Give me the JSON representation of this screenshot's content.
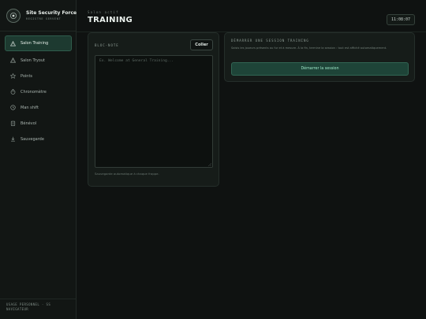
{
  "brand": {
    "title": "Site Security Force",
    "subtitle": "REGISTRE SERVENT"
  },
  "sidebar": {
    "items": [
      {
        "label": "Salon Training",
        "icon": "warning-triangle-icon",
        "active": true
      },
      {
        "label": "Salon Tryout",
        "icon": "warning-triangle-icon",
        "active": false
      },
      {
        "label": "Points",
        "icon": "star-icon",
        "active": false
      },
      {
        "label": "Chronomètre",
        "icon": "stopwatch-icon",
        "active": false
      },
      {
        "label": "Man shift",
        "icon": "clock-icon",
        "active": false
      },
      {
        "label": "Bénévol",
        "icon": "clipboard-icon",
        "active": false
      },
      {
        "label": "Sauvegarde",
        "icon": "download-icon",
        "active": false
      }
    ],
    "footer": "USAGE PERSONNEL · SS NAVIGATEUR"
  },
  "header": {
    "eyebrow": "Salon actif",
    "title": "TRAINING",
    "clock": "11:08:07"
  },
  "notes": {
    "label": "BLOC-NOTE",
    "paste_label": "Coller",
    "placeholder": "Ex. Welcome at General Training...",
    "autosave": "Sauvegarde automatique à chaque frappe."
  },
  "session": {
    "label": "DÉMARRER UNE SESSION TRAINING",
    "description": "Saisis les joueurs présents au fur et à mesure. À la fin, termine la session : tout est affiché automatiquement.",
    "start_label": "Démarrer la session"
  },
  "colors": {
    "accent": "#1e4438",
    "accent_text": "#9ee8c9",
    "background": "#0f1211",
    "hazard_yellow": "#c9a227"
  }
}
